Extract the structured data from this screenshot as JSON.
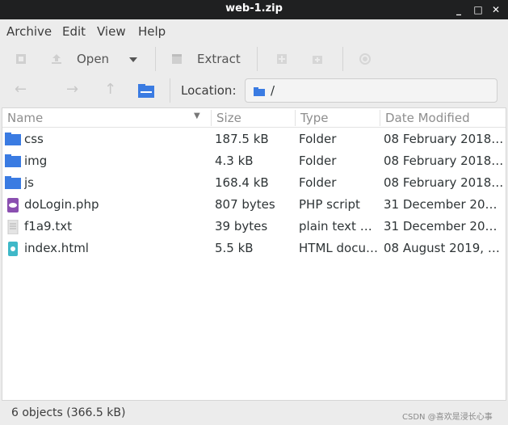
{
  "window": {
    "title": "web-1.zip",
    "minimize": "_",
    "maximize": "□",
    "close": "✕"
  },
  "menu": {
    "archive": "Archive",
    "edit": "Edit",
    "view": "View",
    "help": "Help"
  },
  "toolbar": {
    "open_label": "Open",
    "extract_label": "Extract"
  },
  "location": {
    "label": "Location:",
    "value": "/"
  },
  "columns": {
    "name": "Name",
    "size": "Size",
    "type": "Type",
    "date": "Date Modified"
  },
  "files": [
    {
      "name": "css",
      "size": "187.5 kB",
      "type": "Folder",
      "date": "08 February 2018, …",
      "icon": "folder-icon"
    },
    {
      "name": "img",
      "size": "4.3 kB",
      "type": "Folder",
      "date": "08 February 2018, …",
      "icon": "folder-icon"
    },
    {
      "name": "js",
      "size": "168.4 kB",
      "type": "Folder",
      "date": "08 February 2018, …",
      "icon": "folder-icon"
    },
    {
      "name": "doLogin.php",
      "size": "807 bytes",
      "type": "PHP script",
      "date": "31 December 2020,…",
      "icon": "php-file-icon"
    },
    {
      "name": "f1a9.txt",
      "size": "39 bytes",
      "type": "plain text do…",
      "date": "31 December 2020,…",
      "icon": "text-file-icon"
    },
    {
      "name": "index.html",
      "size": "5.5 kB",
      "type": "HTML docu…",
      "date": "08 August 2019, 00…",
      "icon": "html-file-icon"
    }
  ],
  "status": {
    "text": "6 objects (366.5 kB)",
    "watermark": "CSDN @喜欢是浸长心事"
  },
  "colors": {
    "folder": "#3a7be2",
    "php": "#8a4fb0",
    "html": "#3fb8c8",
    "titlebar": "#1f2021"
  }
}
